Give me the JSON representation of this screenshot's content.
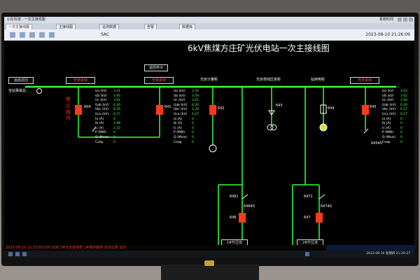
{
  "window": {
    "title_left": "山东科技 · 一次主接线图",
    "title_right": "系统时间"
  },
  "tabs": [
    "一次主接线图",
    "主接线图",
    "遥测数据",
    "告警",
    "数据库"
  ],
  "toolbar": {
    "brand": "SAC",
    "datetime": "2023-08-10 21:26:09"
  },
  "diagram": {
    "title": "6kV焦煤方庄矿光伏电站一次主接线图",
    "accident_label": "全站事故总：",
    "top_button_left": "画面返回",
    "top_button_center": "遥控命令",
    "incoming1_button": "光伏进线",
    "incoming2_button": "光伏进线",
    "incoming3_button": "光伏进线",
    "branch_labels": [
      "光伏计量柜",
      "光伏母线压变柜",
      "站用电柜"
    ],
    "forbid_label": "禁止操作",
    "breaker_ids": {
      "b1": "604",
      "b2": "641",
      "b3": "642",
      "b4": "643",
      "b5": "644",
      "b6": "645",
      "b7": "6461",
      "b8": "646",
      "b9": "6471",
      "b10": "647"
    },
    "switch_ids": {
      "s1": "64640",
      "s2": "64740",
      "s3": "64540"
    },
    "bottom_buttons": [
      "1#升压变",
      "2#升压变"
    ],
    "measure_names": [
      "Ua (kV)",
      "Ub (kV)",
      "Uc (kV)",
      "Uab (kV)",
      "Ubc (kV)",
      "Uca (kV)",
      "Ia (A)",
      "Ib (A)",
      "Ic (A)",
      "P (MW)",
      "Q (Mvar)",
      "Cosφ"
    ],
    "measure_left": [
      "3.31",
      "3.60",
      "3.61",
      "6.30",
      "6.29",
      "6.27",
      "0",
      "1.88",
      "2.33",
      "0",
      "0",
      "0"
    ],
    "measure_mid": [
      "3.31",
      "3.59",
      "3.61",
      "6.30",
      "1.29",
      "6.27",
      "0",
      "0",
      "0",
      "0",
      "0",
      "0"
    ],
    "measure_right": [
      "3.63",
      "3.62",
      "3.60",
      "6.30",
      "6.27",
      "6.27",
      "0",
      "0",
      "0",
      "0",
      "0",
      "0"
    ]
  },
  "status": {
    "event": "2023-08-10 21:23:03.030  SOE  2#光伏进线柜  1#保护跳闸  SOE记录  动作",
    "taskbar_time": "2023-08-10 星期四 21:26:27"
  },
  "colors": {
    "bus": "#39ff39",
    "breaker": "#ff3a1a",
    "text_red": "#ff2a2a",
    "value_green": "#4bff4b"
  }
}
